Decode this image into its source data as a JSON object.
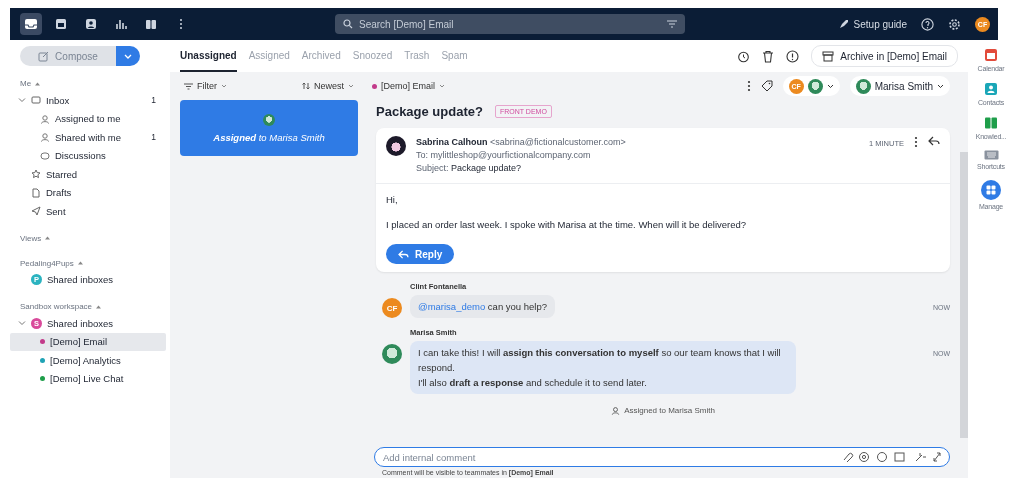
{
  "topbar": {
    "nav_icons": [
      {
        "kind": "inbox",
        "selected": true
      },
      {
        "kind": "calendar",
        "selected": false
      },
      {
        "kind": "contacts",
        "selected": false
      },
      {
        "kind": "analytics",
        "selected": false
      },
      {
        "kind": "knowledge",
        "selected": false
      },
      {
        "kind": "more",
        "selected": false
      }
    ],
    "search": {
      "placeholder": "Search [Demo] Email"
    },
    "setup_guide": "Setup guide",
    "avatar": "CF"
  },
  "sidebar": {
    "compose": "Compose",
    "sections": [
      {
        "title": "Me",
        "items": [
          {
            "label": "Inbox",
            "kind": "inbox",
            "count": "1",
            "expanded": true,
            "selected": false,
            "children": [
              {
                "label": "Assigned to me",
                "kind": "assign",
                "selected": false
              },
              {
                "label": "Shared with me",
                "kind": "shared",
                "count": "1",
                "selected": false
              },
              {
                "label": "Discussions",
                "kind": "chat",
                "selected": false
              }
            ]
          },
          {
            "label": "Starred",
            "kind": "star",
            "selected": false
          },
          {
            "label": "Drafts",
            "kind": "draft",
            "selected": false
          },
          {
            "label": "Sent",
            "kind": "sent",
            "selected": false
          }
        ]
      },
      {
        "title": "Views"
      },
      {
        "title": "Pedaling4Pups",
        "items": [
          {
            "label": "Shared inboxes",
            "badge": "P",
            "color": "#2bb3c0",
            "selected": false
          }
        ]
      },
      {
        "title": "Sandbox workspace",
        "items": [
          {
            "label": "Shared inboxes",
            "badge": "S",
            "color": "#d94a9b",
            "expanded": true,
            "selected": false,
            "children": [
              {
                "label": "[Demo] Email",
                "color": "#c23a8a",
                "selected": true
              },
              {
                "label": "[Demo] Analytics",
                "color": "#1fa3b5",
                "selected": false
              },
              {
                "label": "[Demo] Live Chat",
                "color": "#1e9e4a",
                "selected": false
              }
            ]
          }
        ]
      }
    ]
  },
  "tabs": [
    {
      "label": "Unassigned",
      "selected": true
    },
    {
      "label": "Assigned",
      "selected": false
    },
    {
      "label": "Archived",
      "selected": false
    },
    {
      "label": "Snoozed",
      "selected": false
    },
    {
      "label": "Trash",
      "selected": false
    },
    {
      "label": "Spam",
      "selected": false
    }
  ],
  "archive_button": "Archive in [Demo] Email",
  "list": {
    "filter": "Filter",
    "sort": "Newest",
    "cards": [
      {
        "text": "**Assigned** to Marisa Smith",
        "selected": true
      }
    ]
  },
  "conversation": {
    "inbox": {
      "label": "[Demo] Email",
      "color": "#c23a8a"
    },
    "assignee": "Marisa Smith",
    "participants_avatar": "CF",
    "subject": "Package update?",
    "tag": "FRONT DEMO",
    "email": {
      "sender": "Sabrina Calhoun",
      "address": "<sabrina@fictionalcustomer.com>",
      "to": "To: mylittleshop@yourfictionalcompany.com",
      "subject_label": "Subject:",
      "subject": "Package update?",
      "time": "1 MINUTE",
      "body": [
        "Hi,",
        "I placed an order last week. I spoke with Marisa at the time. When will it be delivered?"
      ],
      "reply": "Reply"
    },
    "comments": [
      {
        "author": "Clint Fontanella",
        "avatar": "CF",
        "kind": "initials",
        "mention": "@marisa_demo",
        "text": " can you help?",
        "time": "NOW"
      },
      {
        "author": "Marisa Smith",
        "kind": "picture",
        "lines": [
          "I can take this! I will **assign this conversation to myself** so our team knows that I will respond.",
          "I'll also **draft a response** and schedule it to send later."
        ],
        "time": "NOW"
      }
    ],
    "event": "Assigned to Marisa Smith",
    "composer": {
      "placeholder": "Add internal comment",
      "note": "Comment will be visible to teammates in **[Demo] Email**"
    }
  },
  "rail": [
    {
      "kind": "calendar",
      "label": "Calendar"
    },
    {
      "kind": "contacts",
      "label": "Contacts"
    },
    {
      "kind": "knowledge",
      "label": "Knowled..."
    },
    {
      "kind": "shortcuts",
      "label": "Shortcuts"
    },
    {
      "kind": "manage",
      "label": "Manage"
    }
  ]
}
